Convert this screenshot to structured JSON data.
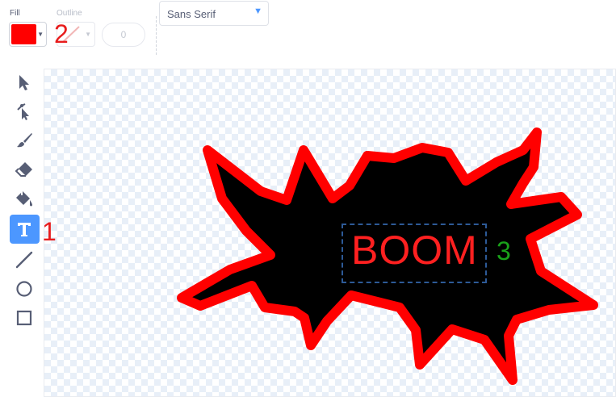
{
  "toolbar_top": {
    "fill_label": "Fill",
    "fill_color": "#ff0000",
    "outline_label": "Outline",
    "outline_width": "0",
    "font": "Sans Serif"
  },
  "tools": [
    {
      "name": "select-tool",
      "icon": "arrow-select-icon",
      "active": false
    },
    {
      "name": "reshape-tool",
      "icon": "reshape-icon",
      "active": false
    },
    {
      "name": "brush-tool",
      "icon": "brush-icon",
      "active": false
    },
    {
      "name": "eraser-tool",
      "icon": "eraser-icon",
      "active": false
    },
    {
      "name": "fill-tool",
      "icon": "paint-bucket-icon",
      "active": false
    },
    {
      "name": "text-tool",
      "icon": "text-icon",
      "active": true
    },
    {
      "name": "line-tool",
      "icon": "line-icon",
      "active": false
    },
    {
      "name": "circle-tool",
      "icon": "circle-icon",
      "active": false
    },
    {
      "name": "rectangle-tool",
      "icon": "rectangle-icon",
      "active": false
    }
  ],
  "canvas": {
    "text": "BOOM",
    "shape_fill": "#000000",
    "shape_outline": "#ff0000"
  },
  "annotations": {
    "one": "1",
    "two": "2",
    "three": "3"
  }
}
